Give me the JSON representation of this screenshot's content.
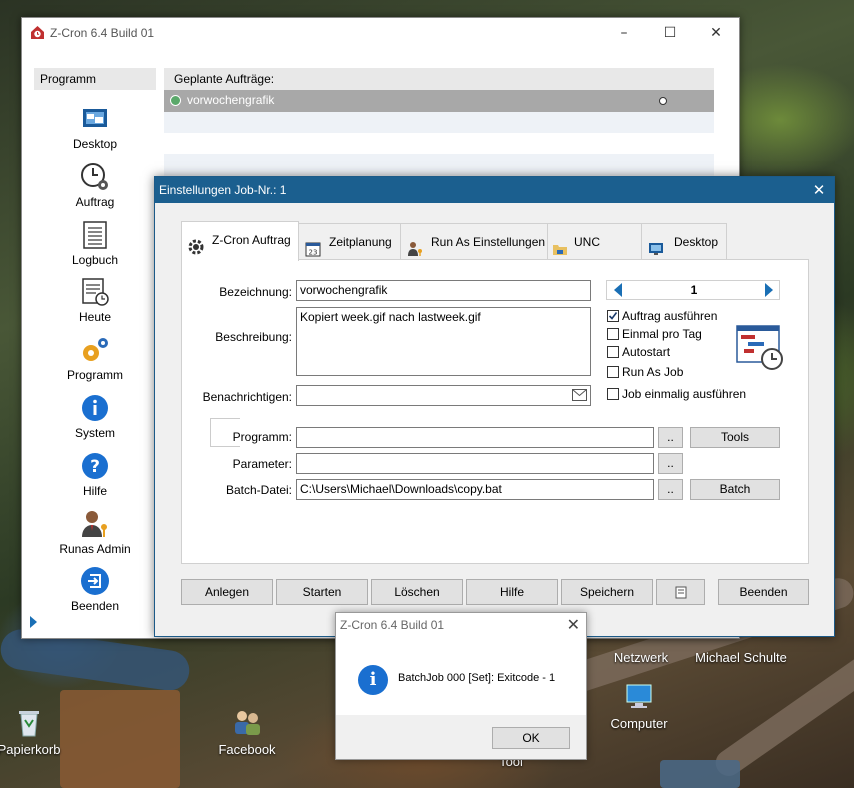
{
  "desktop": {
    "icons": [
      {
        "label": "Papierkorb"
      },
      {
        "label": "Facebook"
      },
      {
        "label": "Netzwerk"
      },
      {
        "label": "Michael Schulte"
      },
      {
        "label": "Computer"
      },
      {
        "label": "Tool"
      }
    ]
  },
  "main_window": {
    "title": "Z-Cron 6.4 Build 01",
    "left_panel": {
      "header": "Programm",
      "items": [
        {
          "label": "Desktop"
        },
        {
          "label": "Auftrag"
        },
        {
          "label": "Logbuch"
        },
        {
          "label": "Heute"
        },
        {
          "label": "Programm"
        },
        {
          "label": "System"
        },
        {
          "label": "Hilfe"
        },
        {
          "label": "Runas Admin"
        },
        {
          "label": "Beenden"
        }
      ]
    },
    "jobs": {
      "header": "Geplante Aufträge:",
      "rows": [
        {
          "name": "vorwochengrafik"
        }
      ]
    }
  },
  "settings_dialog": {
    "title": "Einstellungen Job-Nr.: 1",
    "tabs": [
      {
        "label": "Z-Cron Auftrag"
      },
      {
        "label": "Zeitplanung"
      },
      {
        "label": "Run As Einstellungen"
      },
      {
        "label": "UNC Connect"
      },
      {
        "label": "Desktop"
      }
    ],
    "form": {
      "bezeichnung_label": "Bezeichnung:",
      "bezeichnung_value": "vorwochengrafik",
      "beschreibung_label": "Beschreibung:",
      "beschreibung_value": "Kopiert week.gif nach lastweek.gif",
      "benachrichtigen_label": "Benachrichtigen:",
      "benachrichtigen_value": "",
      "programm_label": "Programm:",
      "programm_value": "",
      "parameter_label": "Parameter:",
      "parameter_value": "",
      "batch_label": "Batch-Datei:",
      "batch_value": "C:\\Users\\Michael\\Downloads\\copy.bat",
      "browse_label": "..",
      "tools_button": "Tools",
      "batch_button": "Batch",
      "job_number": "1"
    },
    "options": [
      {
        "label": "Auftrag ausführen",
        "checked": true
      },
      {
        "label": "Einmal pro Tag",
        "checked": false
      },
      {
        "label": "Autostart",
        "checked": false
      },
      {
        "label": "Run As Job",
        "checked": false
      },
      {
        "label": "Job einmalig ausführen",
        "checked": false
      }
    ],
    "buttons": {
      "anlegen": "Anlegen",
      "starten": "Starten",
      "loeschen": "Löschen",
      "hilfe": "Hilfe",
      "speichern": "Speichern",
      "beenden": "Beenden"
    }
  },
  "message_box": {
    "title": "Z-Cron 6.4 Build 01",
    "message": "BatchJob 000 [Set]: Exitcode - 1",
    "ok_button": "OK"
  },
  "colors": {
    "accent": "#1b5f8f",
    "info_blue": "#1a6fd0",
    "selected_row": "#a8a8a8"
  }
}
